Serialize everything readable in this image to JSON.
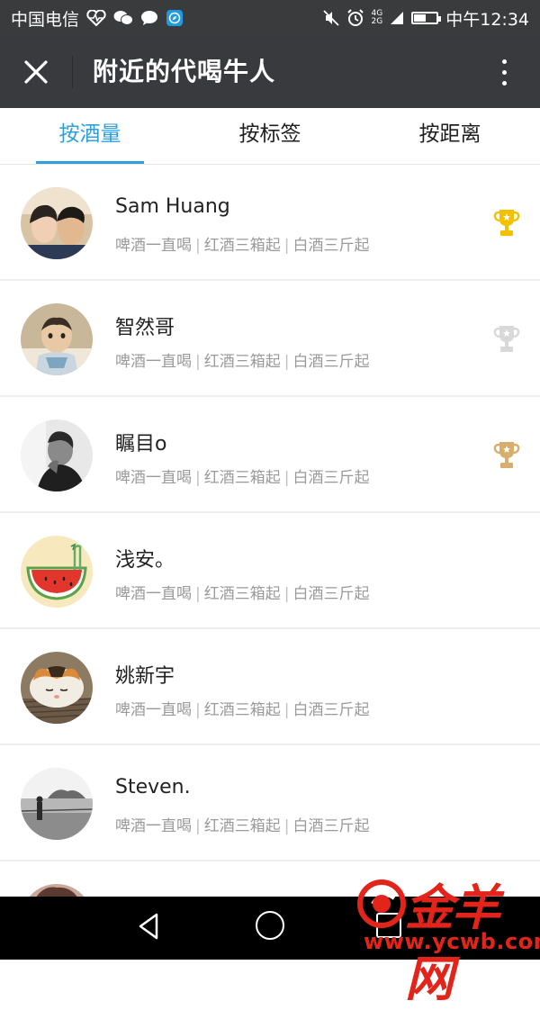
{
  "status_bar": {
    "carrier": "中国电信",
    "time": "中午12:34",
    "network_top": "4G",
    "network_bottom": "2G",
    "battery_level": 0.55
  },
  "header": {
    "title": "附近的代喝牛人"
  },
  "tabs": [
    {
      "label": "按酒量",
      "active": true
    },
    {
      "label": "按标签",
      "active": false
    },
    {
      "label": "按距离",
      "active": false
    }
  ],
  "list": [
    {
      "name": "Sam Huang",
      "tags": [
        "啤酒一直喝",
        "红酒三箱起",
        "白酒三斤起"
      ],
      "trophy": "gold"
    },
    {
      "name": "智然哥",
      "tags": [
        "啤酒一直喝",
        "红酒三箱起",
        "白酒三斤起"
      ],
      "trophy": "silver"
    },
    {
      "name": "瞩目o",
      "tags": [
        "啤酒一直喝",
        "红酒三箱起",
        "白酒三斤起"
      ],
      "trophy": "bronze"
    },
    {
      "name": "浅安。",
      "tags": [
        "啤酒一直喝",
        "红酒三箱起",
        "白酒三斤起"
      ],
      "trophy": ""
    },
    {
      "name": "姚新宇",
      "tags": [
        "啤酒一直喝",
        "红酒三箱起",
        "白酒三斤起"
      ],
      "trophy": ""
    },
    {
      "name": "Steven.",
      "tags": [
        "啤酒一直喝",
        "红酒三箱起",
        "白酒三斤起"
      ],
      "trophy": ""
    }
  ],
  "separator": "|",
  "colors": {
    "accent": "#2ea0dc",
    "header_bg": "#393a3e",
    "gold": "#f2c200",
    "silver": "#d8d8d8",
    "bronze": "#d9ad6c"
  },
  "watermark": {
    "brand": "金羊网",
    "url": "www.ycwb.com"
  }
}
